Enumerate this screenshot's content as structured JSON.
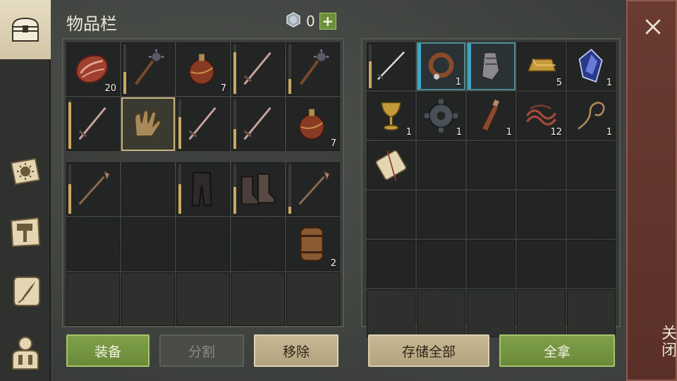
{
  "header": {
    "title": "物品栏",
    "currency_amount": "0",
    "plus_label": "+"
  },
  "close": {
    "label": "关闭"
  },
  "sidebar": {
    "tabs": [
      {
        "icon": "chest-icon"
      },
      {
        "icon": "sun-book-icon"
      },
      {
        "icon": "hammer-map-icon"
      },
      {
        "icon": "scroll-quill-icon"
      },
      {
        "icon": "character-icon"
      }
    ]
  },
  "inventory": {
    "slots": [
      {
        "icon": "meat-icon",
        "count": "20",
        "durability": null
      },
      {
        "icon": "mace-icon",
        "count": "",
        "durability": 0.45
      },
      {
        "icon": "flask-icon",
        "count": "7",
        "durability": null
      },
      {
        "icon": "sword-icon",
        "count": "",
        "durability": 0.85
      },
      {
        "icon": "mace-icon",
        "count": "",
        "durability": 0.3
      },
      {
        "icon": "sword-icon",
        "count": "",
        "durability": 0.95
      },
      {
        "icon": "gloves-icon",
        "count": "",
        "durability": null,
        "selected": true
      },
      {
        "icon": "sword-icon",
        "count": "",
        "durability": 0.65
      },
      {
        "icon": "sword-icon",
        "count": "",
        "durability": 0.4
      },
      {
        "icon": "flask-icon",
        "count": "7",
        "durability": null
      },
      {
        "icon": "spear-icon",
        "count": "",
        "durability": 0.6
      },
      {
        "icon": "",
        "count": "",
        "durability": null
      },
      {
        "icon": "pants-icon",
        "count": "",
        "durability": 0.6
      },
      {
        "icon": "boots-icon",
        "count": "",
        "durability": 0.55
      },
      {
        "icon": "spear-icon",
        "count": "",
        "durability": 0.15
      },
      {
        "icon": "",
        "count": "",
        "durability": null
      },
      {
        "icon": "",
        "count": "",
        "durability": null
      },
      {
        "icon": "",
        "count": "",
        "durability": null
      },
      {
        "icon": "",
        "count": "",
        "durability": null
      },
      {
        "icon": "barrel-icon",
        "count": "2",
        "durability": null
      },
      {
        "icon": "",
        "count": "",
        "durability": null
      },
      {
        "icon": "",
        "count": "",
        "durability": null
      },
      {
        "icon": "",
        "count": "",
        "durability": null
      },
      {
        "icon": "",
        "count": "",
        "durability": null
      },
      {
        "icon": "",
        "count": "",
        "durability": null
      }
    ]
  },
  "storage": {
    "slots": [
      {
        "icon": "katana-icon",
        "count": "",
        "durability": 0.55
      },
      {
        "icon": "collar-icon",
        "count": "1",
        "durability": null,
        "highlight": true
      },
      {
        "icon": "gauntlet-icon",
        "count": "",
        "durability": null,
        "highlight": true
      },
      {
        "icon": "gold-bar-icon",
        "count": "5",
        "durability": null
      },
      {
        "icon": "crystal-icon",
        "count": "1",
        "durability": null
      },
      {
        "icon": "goblet-icon",
        "count": "1",
        "durability": null
      },
      {
        "icon": "gear-icon",
        "count": "1",
        "durability": null
      },
      {
        "icon": "bottle-icon",
        "count": "1",
        "durability": null
      },
      {
        "icon": "rope-bundle-icon",
        "count": "12",
        "durability": null
      },
      {
        "icon": "rope-icon",
        "count": "1",
        "durability": null
      },
      {
        "icon": "scroll-icon",
        "count": "",
        "durability": null
      },
      {
        "icon": "",
        "count": "",
        "durability": null
      },
      {
        "icon": "",
        "count": "",
        "durability": null
      },
      {
        "icon": "",
        "count": "",
        "durability": null
      },
      {
        "icon": "",
        "count": "",
        "durability": null
      },
      {
        "icon": "",
        "count": "",
        "durability": null
      },
      {
        "icon": "",
        "count": "",
        "durability": null
      },
      {
        "icon": "",
        "count": "",
        "durability": null
      },
      {
        "icon": "",
        "count": "",
        "durability": null
      },
      {
        "icon": "",
        "count": "",
        "durability": null
      },
      {
        "icon": "",
        "count": "",
        "durability": null
      },
      {
        "icon": "",
        "count": "",
        "durability": null
      },
      {
        "icon": "",
        "count": "",
        "durability": null
      },
      {
        "icon": "",
        "count": "",
        "durability": null
      },
      {
        "icon": "",
        "count": "",
        "durability": null
      },
      {
        "icon": "",
        "count": "",
        "durability": null
      },
      {
        "icon": "",
        "count": "",
        "durability": null
      },
      {
        "icon": "",
        "count": "",
        "durability": null
      },
      {
        "icon": "",
        "count": "",
        "durability": null
      },
      {
        "icon": "",
        "count": "",
        "durability": null
      }
    ]
  },
  "buttons": {
    "equip": "装备",
    "split": "分割",
    "remove": "移除",
    "store_all": "存储全部",
    "take_all": "全拿"
  }
}
